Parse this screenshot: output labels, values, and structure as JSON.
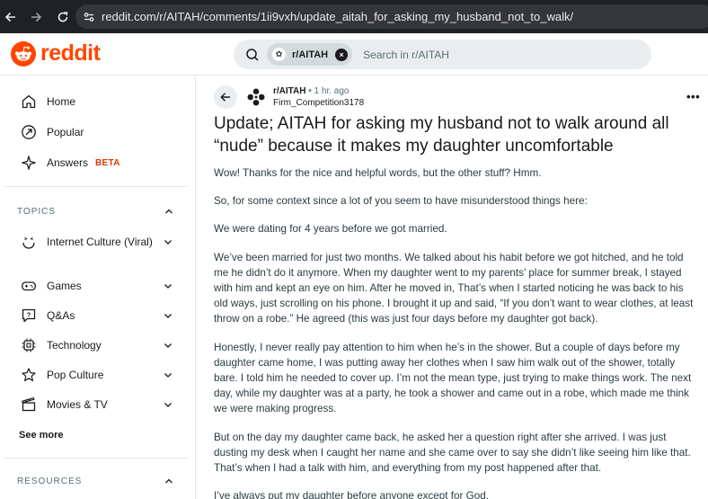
{
  "browser": {
    "url": "reddit.com/r/AITAH/comments/1ii9vxh/update_aitah_for_asking_my_husband_not_to_walk/"
  },
  "header": {
    "logo_text": "reddit",
    "search_chip": "r/AITAH",
    "search_placeholder": "Search in r/AITAH"
  },
  "sidebar": {
    "items": [
      {
        "label": "Home",
        "icon": "home-icon"
      },
      {
        "label": "Popular",
        "icon": "popular-icon"
      },
      {
        "label": "Answers",
        "badge": "BETA",
        "icon": "answers-icon"
      }
    ],
    "topics_heading": "TOPICS",
    "topics": [
      {
        "label": "Internet Culture (Viral)",
        "icon": "internet-culture-icon"
      },
      {
        "label": "Games",
        "icon": "gamepad-icon"
      },
      {
        "label": "Q&As",
        "icon": "qa-icon"
      },
      {
        "label": "Technology",
        "icon": "chip-icon"
      },
      {
        "label": "Pop Culture",
        "icon": "star-icon"
      },
      {
        "label": "Movies & TV",
        "icon": "clapperboard-icon"
      }
    ],
    "see_more": "See more",
    "resources_heading": "RESOURCES"
  },
  "post": {
    "subreddit": "r/AITAH",
    "time": "1 hr. ago",
    "author": "Firm_Competition3178",
    "more": "•••",
    "title": "Update; AITAH for asking my husband not to walk around all “nude” because it makes my daughter uncomfortable",
    "paragraphs": [
      "Wow! Thanks for the nice and helpful words, but the other stuff? Hmm.",
      "So, for some context since a lot of you seem to have misunderstood things here:",
      "We were dating for 4 years before we got married.",
      "We’ve been married for just two months. We talked about his habit before we got hitched, and he told me he didn’t do it anymore. When my daughter went to my parents’ place for summer break, I stayed with him and kept an eye on him. After he moved in, That’s when I started noticing he was back to his old ways, just scrolling on his phone. I brought it up and said, “If you don’t want to wear clothes, at least throw on a robe.” He agreed (this was just four days before my daughter got back).",
      "Honestly, I never really pay attention to him when he’s in the shower. But a couple of days before my daughter came home, I was putting away her clothes when I saw him walk out of the shower, totally bare. I told him he needed to cover up. I’m not the mean type, just trying to make things work. The next day, while my daughter was at a party, he took a shower and came out in a robe, which made me think we were making progress.",
      "But on the day my daughter came back, he asked her a question right after she arrived. I was just dusting my desk when I caught her name and she came over to say she didn’t like seeing him like that. That’s when I had a talk with him, and everything from my post happened after that.",
      "I’ve always put my daughter before anyone except for God."
    ]
  },
  "colors": {
    "brand": "#ff4500",
    "beta": "#d93900",
    "text": "#1a1a1b",
    "muted": "#576f76"
  }
}
